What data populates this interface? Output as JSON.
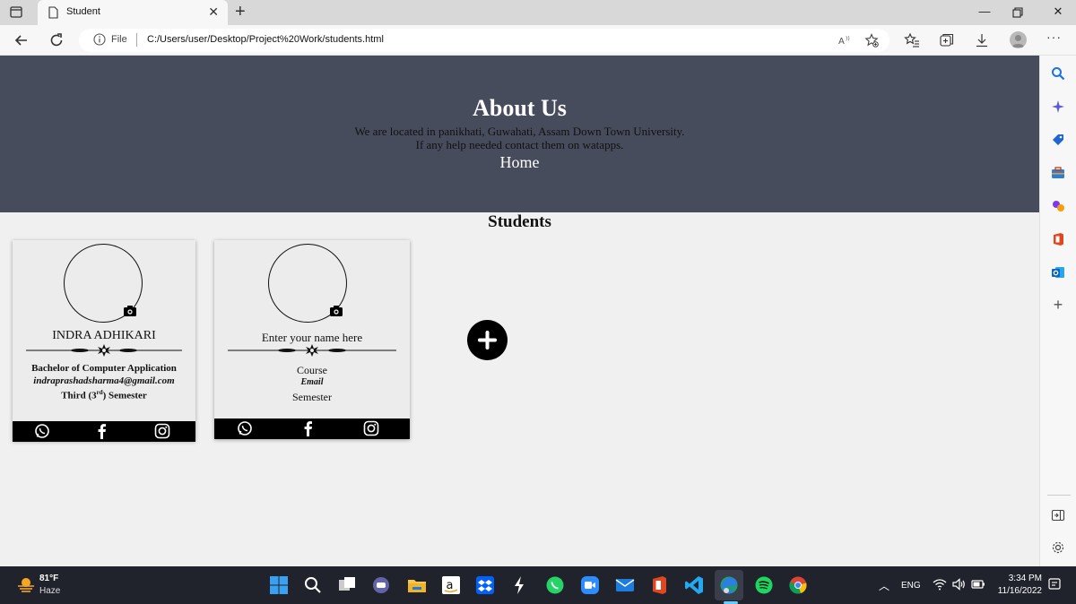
{
  "browser": {
    "tab_title": "Student",
    "url_scheme_label": "File",
    "url": "C:/Users/user/Desktop/Project%20Work/students.html"
  },
  "hero": {
    "title": "About Us",
    "description_line1": "We are located in panikhati, Guwahati, Assam Down Town University.",
    "description_line2": "If any help needed contact them on watapps.",
    "home_link": "Home"
  },
  "students": {
    "section_title": "Students",
    "cards": [
      {
        "name": "INDRA ADHIKARI",
        "course": "Bachelor of Computer Application",
        "email": "indraprashadsharma4@gmail.com",
        "semester_prefix": "Third (3",
        "semester_sup": "rd",
        "semester_suffix": ") Semester"
      },
      {
        "name_placeholder": "Enter your name here",
        "course_placeholder": "Course",
        "email_placeholder": "Email",
        "semester_placeholder": "Semester"
      }
    ],
    "social_icons": [
      "whatsapp-icon",
      "facebook-icon",
      "instagram-icon"
    ],
    "add_button_icon": "plus-icon"
  },
  "taskbar": {
    "weather_temp": "81°F",
    "weather_condition": "Haze",
    "language": "ENG",
    "time": "3:34 PM",
    "date": "11/16/2022"
  },
  "colors": {
    "hero_bg": "#474c5d",
    "page_bg": "#f0f0f0",
    "card_bg": "#ececec",
    "taskbar_bg": "#20232c"
  }
}
